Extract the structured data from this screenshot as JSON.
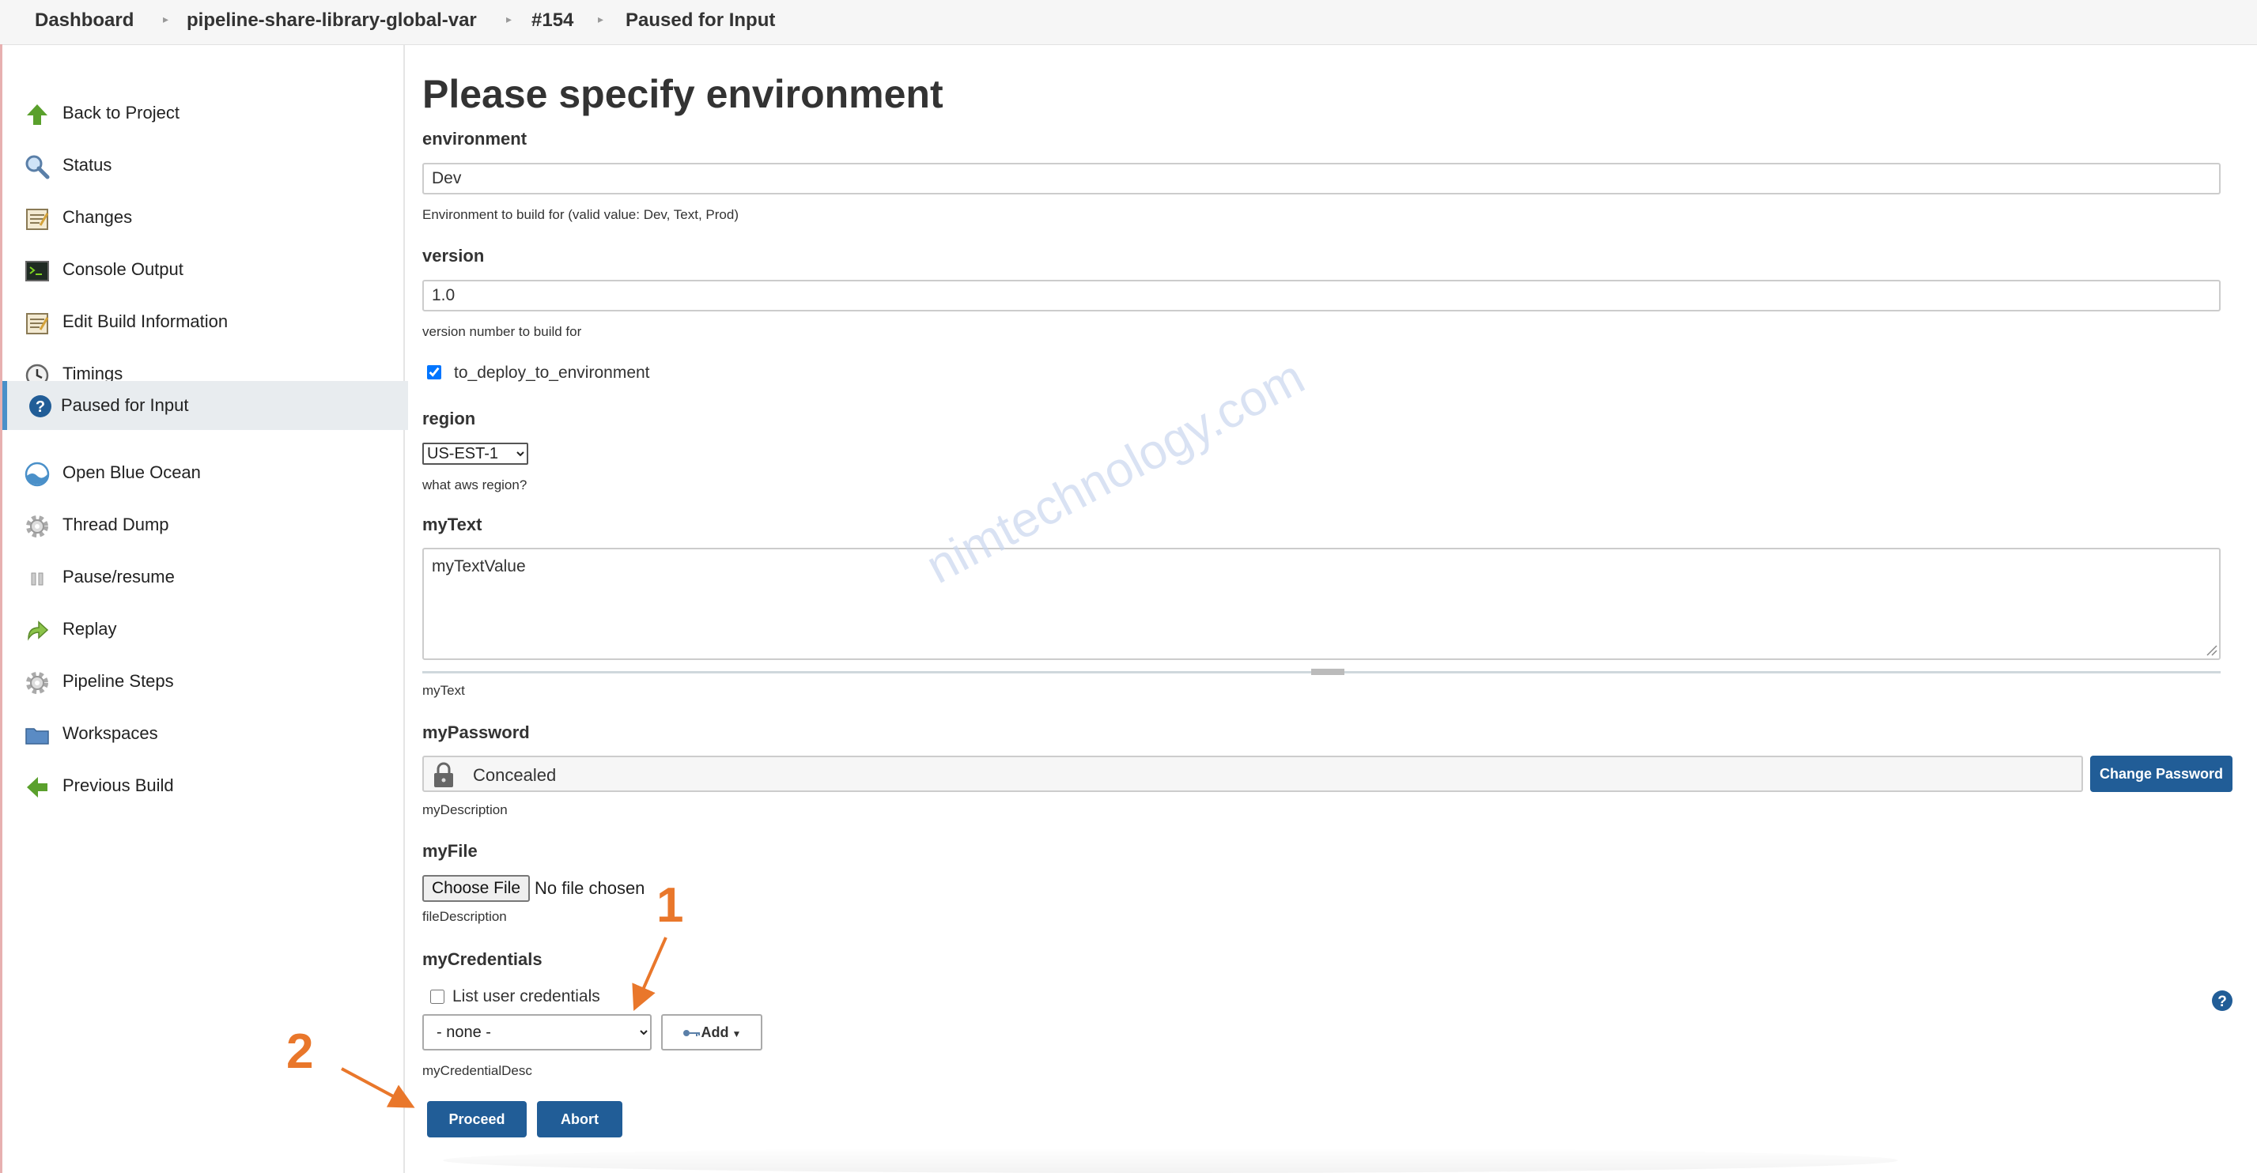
{
  "breadcrumb": [
    "Dashboard",
    "pipeline-share-library-global-var",
    "#154",
    "Paused for Input"
  ],
  "sidebar": {
    "items": [
      {
        "label": "Back to Project",
        "icon": "up-arrow-icon"
      },
      {
        "label": "Status",
        "icon": "magnifier-icon"
      },
      {
        "label": "Changes",
        "icon": "notepad-icon"
      },
      {
        "label": "Console Output",
        "icon": "terminal-icon"
      },
      {
        "label": "Edit Build Information",
        "icon": "notepad-icon"
      },
      {
        "label": "Timings",
        "icon": "clock-icon"
      },
      {
        "label": "Paused for Input",
        "icon": "help-circle-icon"
      },
      {
        "label": "Open Blue Ocean",
        "icon": "blue-ocean-icon"
      },
      {
        "label": "Thread Dump",
        "icon": "gear-icon"
      },
      {
        "label": "Pause/resume",
        "icon": "pause-icon"
      },
      {
        "label": "Replay",
        "icon": "replay-arrow-icon"
      },
      {
        "label": "Pipeline Steps",
        "icon": "gear-icon"
      },
      {
        "label": "Workspaces",
        "icon": "folder-icon"
      },
      {
        "label": "Previous Build",
        "icon": "left-arrow-icon"
      }
    ]
  },
  "form": {
    "title": "Please specify environment",
    "environment": {
      "label": "environment",
      "value": "Dev",
      "description": "Environment to build for (valid value: Dev, Text, Prod)"
    },
    "version": {
      "label": "version",
      "value": "1.0",
      "description": "version number to build for"
    },
    "deploy_checkbox": {
      "label": "to_deploy_to_environment",
      "checked": true
    },
    "region": {
      "label": "region",
      "selected": "US-EST-1",
      "description": "what aws region?"
    },
    "mytext": {
      "label": "myText",
      "value": "myTextValue",
      "description": "myText"
    },
    "mypassword": {
      "label": "myPassword",
      "value": "Concealed",
      "button": "Change Password",
      "description": "myDescription"
    },
    "myfile": {
      "label": "myFile",
      "button": "Choose File",
      "status": "No file chosen",
      "description": "fileDescription"
    },
    "mycredentials": {
      "label": "myCredentials",
      "list_user_label": "List user credentials",
      "list_user_checked": false,
      "selected": "- none -",
      "add_label": "Add",
      "description": "myCredentialDesc"
    },
    "proceed": "Proceed",
    "abort": "Abort"
  },
  "watermark": "nimtechnology.com",
  "annotations": [
    "1",
    "2"
  ],
  "colors": {
    "primary_button": "#215d97",
    "annotation": "#e9772b",
    "active_nav": "#e8ecef"
  }
}
